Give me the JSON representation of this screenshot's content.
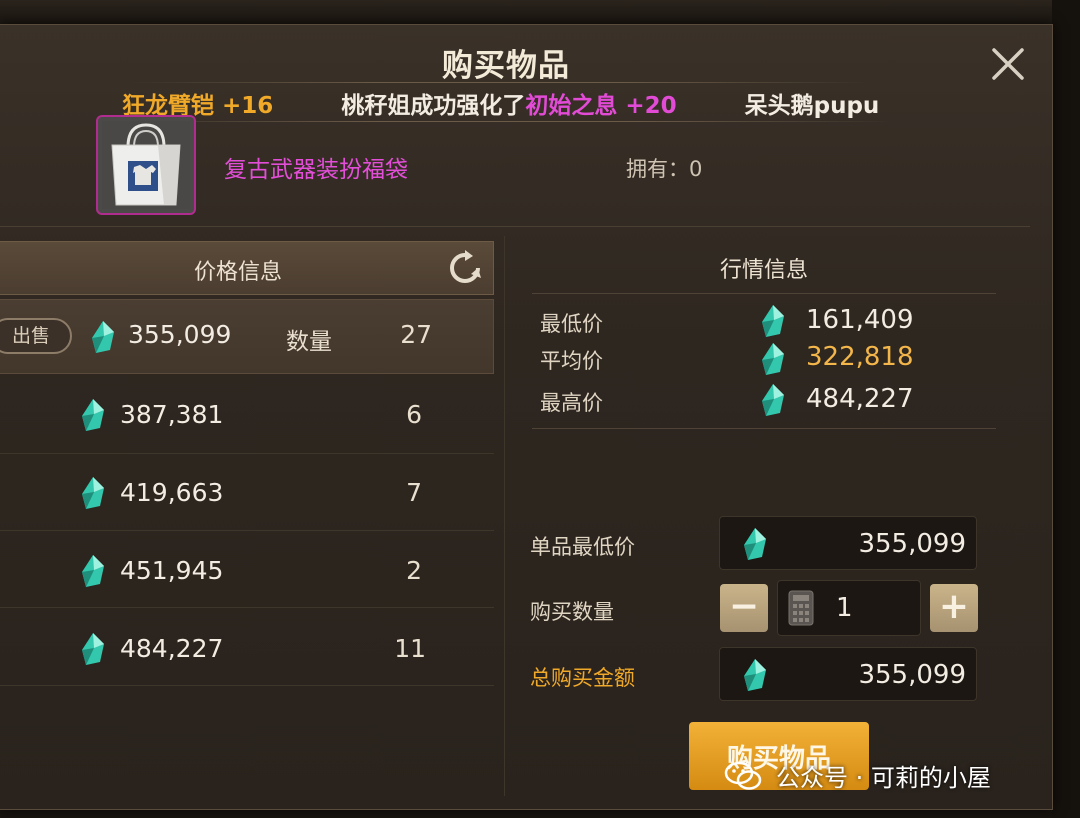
{
  "window": {
    "title": "购买物品"
  },
  "ticker": {
    "part1": "狂龙臂铠 +16",
    "part2_prefix": "桃秄姐成功强化了",
    "part2_item": "初始之息 +20",
    "part3": "呆头鹅pupu"
  },
  "item": {
    "name": "复古武器装扮福袋",
    "owned_label": "拥有：0",
    "icon": "gift-bag-icon"
  },
  "price_panel": {
    "header": "价格信息",
    "sell_button": "出售",
    "qty_label": "数量",
    "rows": [
      {
        "price": "355,099",
        "qty": "27"
      },
      {
        "price": "387,381",
        "qty": "6"
      },
      {
        "price": "419,663",
        "qty": "7"
      },
      {
        "price": "451,945",
        "qty": "2"
      },
      {
        "price": "484,227",
        "qty": "11"
      }
    ]
  },
  "market_panel": {
    "header": "行情信息",
    "lowest_label": "最低价",
    "lowest_value": "161,409",
    "average_label": "平均价",
    "average_value": "322,818",
    "highest_label": "最高价",
    "highest_value": "484,227"
  },
  "purchase": {
    "unit_price_label": "单品最低价",
    "unit_price_value": "355,099",
    "quantity_label": "购买数量",
    "quantity_value": "1",
    "decrement": "−",
    "increment": "+",
    "total_label": "总购买金额",
    "total_value": "355,099",
    "buy_button": "购买物品"
  },
  "watermark": {
    "text": "公众号 · 可莉的小屋"
  },
  "colors": {
    "gold": "#f0a928",
    "pink": "#e24bd6",
    "gem": "#3fd6b8",
    "button": "#e09a1f"
  }
}
